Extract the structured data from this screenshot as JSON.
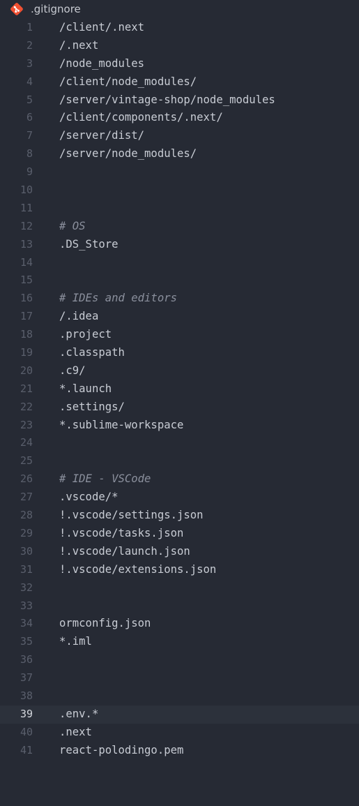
{
  "file": {
    "name": ".gitignore",
    "icon": "git-icon",
    "icon_color": "#f05133"
  },
  "editor": {
    "active_line": 39,
    "colors": {
      "background": "#262a34",
      "active_line_bg": "#2c313b",
      "text": "#c8ccd4",
      "comment": "#8a8f9c",
      "gutter": "#5a5f6c"
    },
    "lines": [
      {
        "num": "1",
        "text": "/client/.next",
        "comment": false
      },
      {
        "num": "2",
        "text": "/.next",
        "comment": false
      },
      {
        "num": "3",
        "text": "/node_modules",
        "comment": false
      },
      {
        "num": "4",
        "text": "/client/node_modules/",
        "comment": false
      },
      {
        "num": "5",
        "text": "/server/vintage-shop/node_modules",
        "comment": false
      },
      {
        "num": "6",
        "text": "/client/components/.next/",
        "comment": false
      },
      {
        "num": "7",
        "text": "/server/dist/",
        "comment": false
      },
      {
        "num": "8",
        "text": "/server/node_modules/",
        "comment": false
      },
      {
        "num": "9",
        "text": "",
        "comment": false
      },
      {
        "num": "10",
        "text": "",
        "comment": false
      },
      {
        "num": "11",
        "text": "",
        "comment": false
      },
      {
        "num": "12",
        "text": "# OS",
        "comment": true
      },
      {
        "num": "13",
        "text": ".DS_Store",
        "comment": false
      },
      {
        "num": "14",
        "text": "",
        "comment": false
      },
      {
        "num": "15",
        "text": "",
        "comment": false
      },
      {
        "num": "16",
        "text": "# IDEs and editors",
        "comment": true
      },
      {
        "num": "17",
        "text": "/.idea",
        "comment": false
      },
      {
        "num": "18",
        "text": ".project",
        "comment": false
      },
      {
        "num": "19",
        "text": ".classpath",
        "comment": false
      },
      {
        "num": "20",
        "text": ".c9/",
        "comment": false
      },
      {
        "num": "21",
        "text": "*.launch",
        "comment": false
      },
      {
        "num": "22",
        "text": ".settings/",
        "comment": false
      },
      {
        "num": "23",
        "text": "*.sublime-workspace",
        "comment": false
      },
      {
        "num": "24",
        "text": "",
        "comment": false
      },
      {
        "num": "25",
        "text": "",
        "comment": false
      },
      {
        "num": "26",
        "text": "# IDE - VSCode",
        "comment": true
      },
      {
        "num": "27",
        "text": ".vscode/*",
        "comment": false
      },
      {
        "num": "28",
        "text": "!.vscode/settings.json",
        "comment": false
      },
      {
        "num": "29",
        "text": "!.vscode/tasks.json",
        "comment": false
      },
      {
        "num": "30",
        "text": "!.vscode/launch.json",
        "comment": false
      },
      {
        "num": "31",
        "text": "!.vscode/extensions.json",
        "comment": false
      },
      {
        "num": "32",
        "text": "",
        "comment": false
      },
      {
        "num": "33",
        "text": "",
        "comment": false
      },
      {
        "num": "34",
        "text": "ormconfig.json",
        "comment": false
      },
      {
        "num": "35",
        "text": "*.iml",
        "comment": false
      },
      {
        "num": "36",
        "text": "",
        "comment": false
      },
      {
        "num": "37",
        "text": "",
        "comment": false
      },
      {
        "num": "38",
        "text": "",
        "comment": false
      },
      {
        "num": "39",
        "text": ".env.*",
        "comment": false
      },
      {
        "num": "40",
        "text": ".next",
        "comment": false
      },
      {
        "num": "41",
        "text": "react-polodingo.pem",
        "comment": false
      }
    ]
  }
}
